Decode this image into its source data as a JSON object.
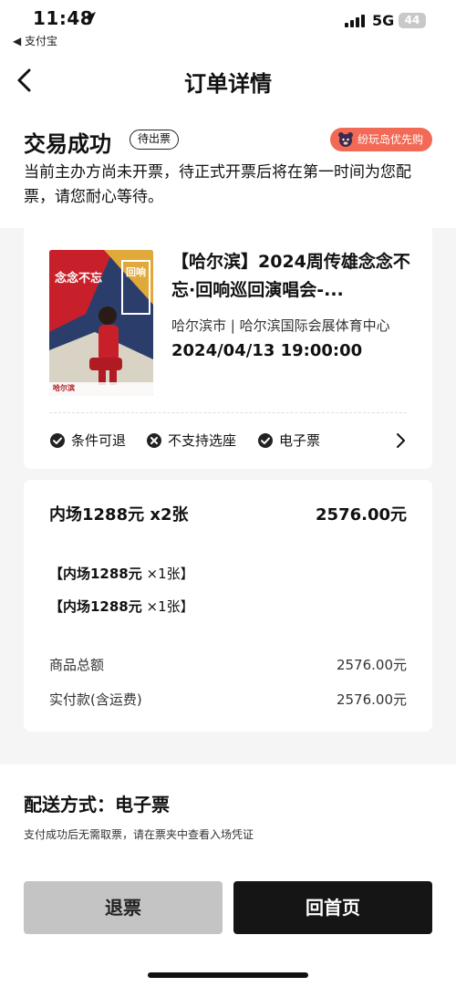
{
  "status_bar": {
    "time": "11:48",
    "back_app": "◀ 支付宝",
    "network": "5G",
    "battery": "44"
  },
  "nav": {
    "title": "订单详情"
  },
  "order_status": {
    "title": "交易成功",
    "badge": "待出票",
    "promo": "纷玩岛优先购",
    "description": "当前主办方尚未开票，待正式开票后将在第一时间为您配票，请您耐心等待。"
  },
  "event": {
    "title": "【哈尔滨】2024周传雄念念不忘·回响巡回演唱会-...",
    "venue": "哈尔滨市 | 哈尔滨国际会展体育中心",
    "datetime": "2024/04/13 19:00:00",
    "poster_text": "念念不忘",
    "poster_text2": "回响",
    "poster_city": "哈尔滨",
    "tags": [
      {
        "label": "条件可退",
        "icon": "check-circle-icon"
      },
      {
        "label": "不支持选座",
        "icon": "x-circle-icon"
      },
      {
        "label": "电子票",
        "icon": "check-circle-icon"
      }
    ]
  },
  "price": {
    "ticket_summary": "内场1288元 x2张",
    "ticket_total": "2576.00元",
    "items": [
      {
        "name": "【内场1288元",
        "qty": " ×1张】"
      },
      {
        "name": "【内场1288元",
        "qty": " ×1张】"
      }
    ],
    "subtotal_label": "商品总额",
    "subtotal_value": "2576.00元",
    "paid_label": "实付款(含运费)",
    "paid_value": "2576.00元"
  },
  "delivery": {
    "title": "配送方式：电子票",
    "note": "支付成功后无需取票，请在票夹中查看入场凭证"
  },
  "actions": {
    "refund": "退票",
    "home": "回首页"
  },
  "colors": {
    "promo": "#f26a55",
    "primary_button": "#151515",
    "secondary_button": "#c4c4c4",
    "poster_red": "#c8202a"
  }
}
